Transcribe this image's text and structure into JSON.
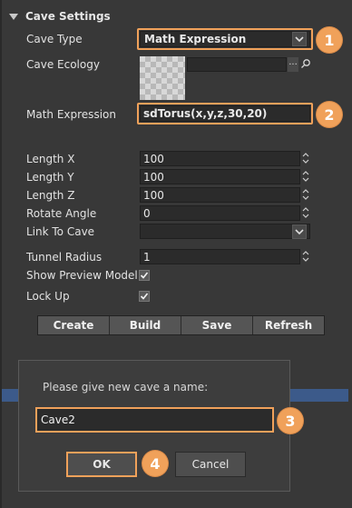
{
  "section": {
    "title": "Cave Settings",
    "expanded": true
  },
  "fields": {
    "cave_type": {
      "label": "Cave Type",
      "value": "Math Expression"
    },
    "cave_ecology": {
      "label": "Cave Ecology",
      "value": "",
      "dots": "···"
    },
    "math_expression": {
      "label": "Math Expression",
      "value": "sdTorus(x,y,z,30,20)"
    },
    "length_x": {
      "label": "Length X",
      "value": "100"
    },
    "length_y": {
      "label": "Length Y",
      "value": "100"
    },
    "length_z": {
      "label": "Length Z",
      "value": "100"
    },
    "rotate_angle": {
      "label": "Rotate Angle",
      "value": "0"
    },
    "link_to_cave": {
      "label": "Link To Cave",
      "value": ""
    },
    "tunnel_radius": {
      "label": "Tunnel Radius",
      "value": "1"
    },
    "show_preview_model": {
      "label": "Show Preview Model",
      "checked": true
    },
    "lock_up": {
      "label": "Lock Up",
      "checked": true
    }
  },
  "actions": {
    "create": "Create",
    "build": "Build",
    "save": "Save",
    "refresh": "Refresh"
  },
  "dialog": {
    "prompt": "Please give new cave a name:",
    "name_value": "Cave2",
    "ok_label": "OK",
    "cancel_label": "Cancel"
  },
  "badges": [
    "1",
    "2",
    "3",
    "4"
  ],
  "colors": {
    "highlight": "#f0a15a",
    "selection_strip": "#3c5a8a"
  },
  "icons": [
    "triangle-down-icon",
    "chevron-down-icon",
    "object-picker-icon",
    "spinner-arrows-icon",
    "checkmark-icon"
  ]
}
